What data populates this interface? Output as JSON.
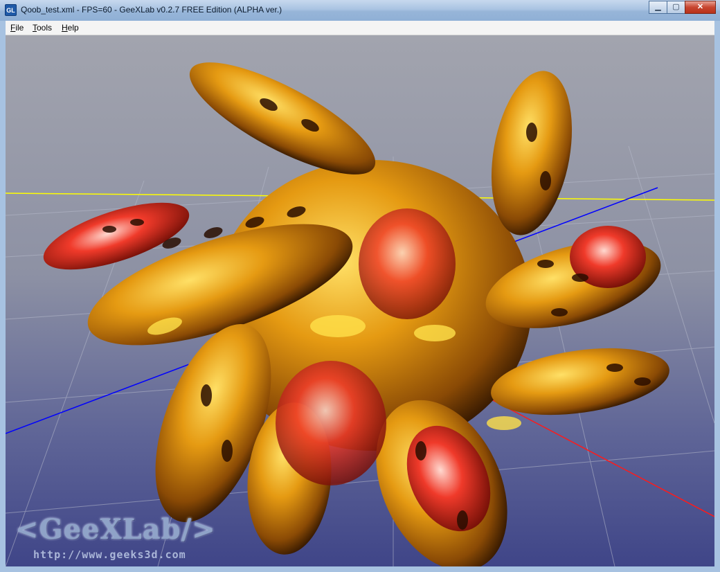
{
  "window": {
    "title": "Qoob_test.xml - FPS=60 - GeeXLab v0.2.7 FREE Edition (ALPHA ver.)",
    "icon_label": "GL",
    "minimize_glyph": "▁",
    "maximize_glyph": "▢",
    "close_glyph": "✕"
  },
  "menu": {
    "file_hotkey": "F",
    "file_rest": "ile",
    "tools_hotkey": "T",
    "tools_rest": "ools",
    "help_hotkey": "H",
    "help_rest": "elp"
  },
  "viewport": {
    "logo_text": "<GeeXLab/>",
    "url_text": "http://www.geeks3d.com",
    "colors": {
      "x_axis": "#ff1a1a",
      "y_axis": "#ffff00",
      "z_axis": "#0000ff",
      "model_primary": "#e08a0a",
      "model_accent": "#e8262a"
    }
  }
}
